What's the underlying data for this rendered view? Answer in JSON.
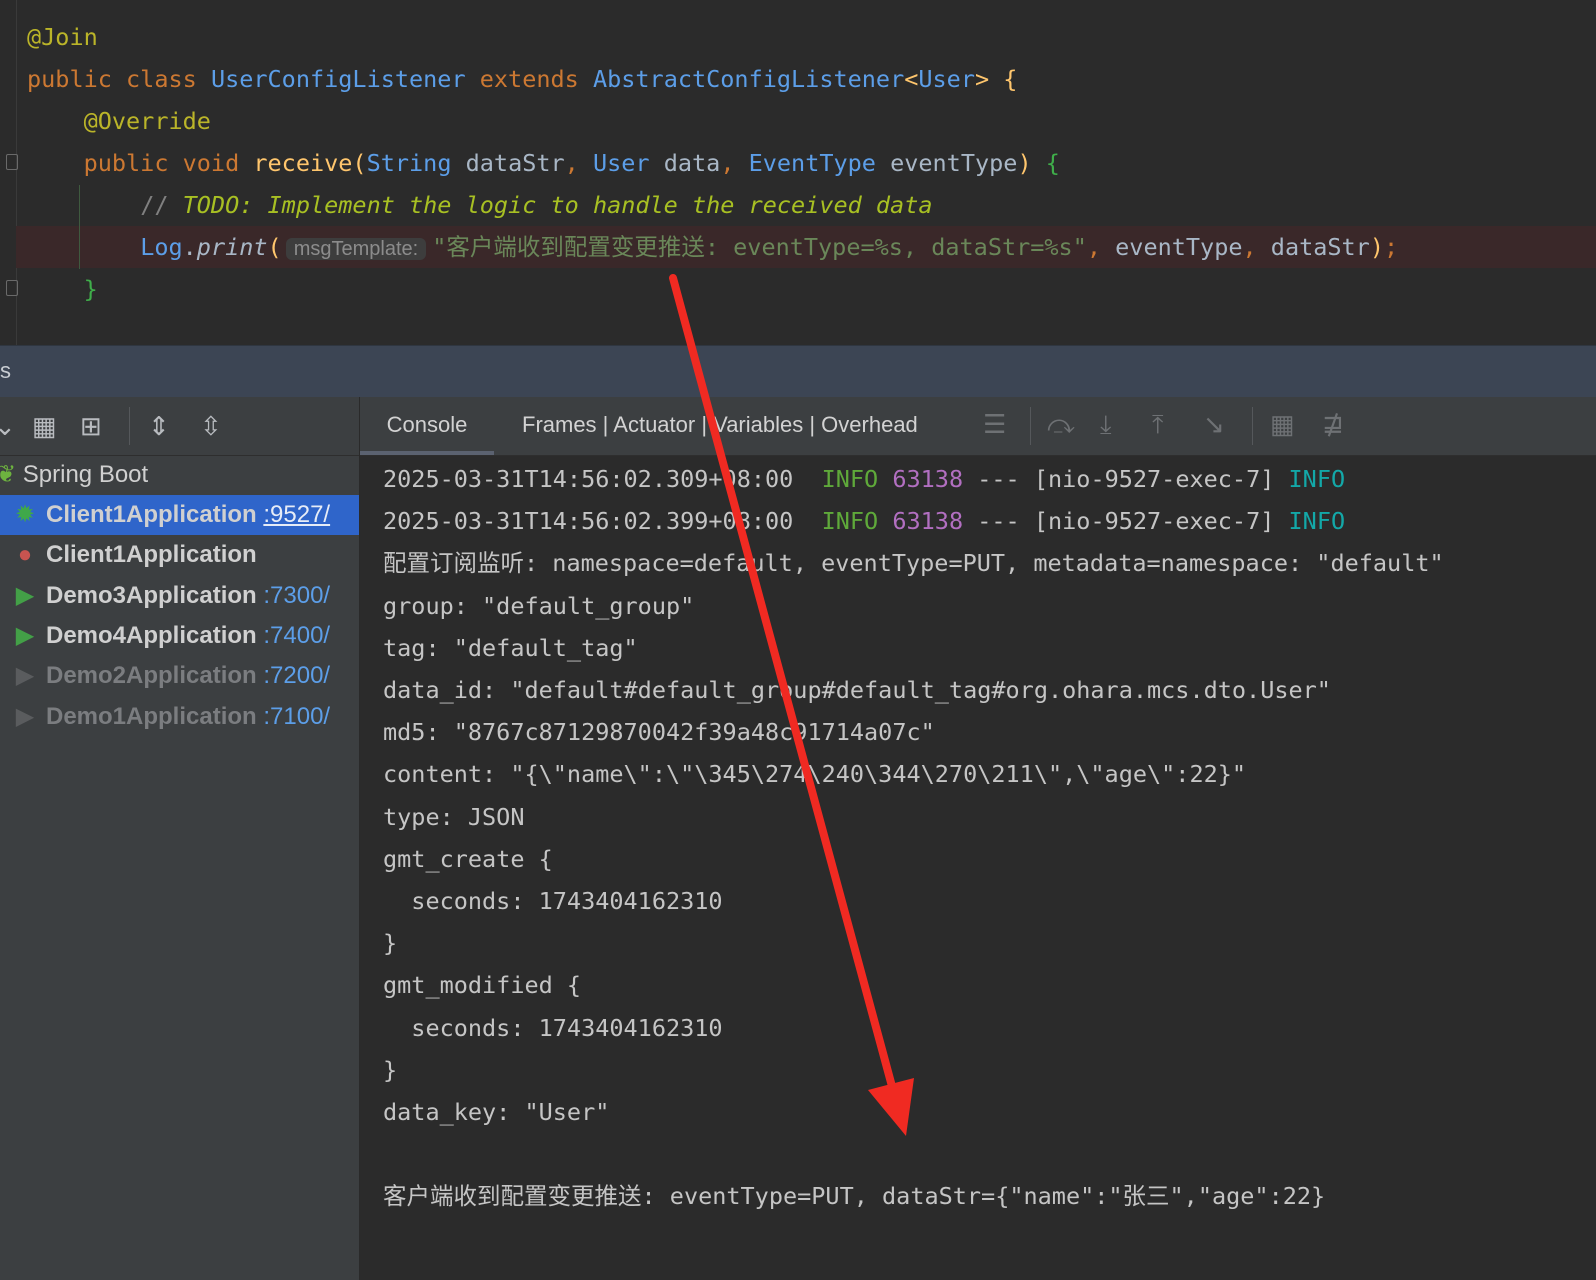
{
  "editor": {
    "lines": [
      [
        {
          "t": "@Join",
          "c": "ann"
        }
      ],
      [
        {
          "t": "public class ",
          "c": "kw"
        },
        {
          "t": "UserConfigListener ",
          "c": "ty"
        },
        {
          "t": "extends ",
          "c": "kw"
        },
        {
          "t": "AbstractConfigListener",
          "c": "ty"
        },
        {
          "t": "<",
          "c": "fn"
        },
        {
          "t": "User",
          "c": "ty"
        },
        {
          "t": "> {",
          "c": "fn"
        }
      ],
      [
        {
          "t": "    "
        },
        {
          "t": "@Override",
          "c": "ann"
        }
      ],
      [
        {
          "t": "    "
        },
        {
          "t": "public void ",
          "c": "kw"
        },
        {
          "t": "receive",
          "c": "fn"
        },
        {
          "t": "(",
          "c": "fn"
        },
        {
          "t": "String ",
          "c": "ty"
        },
        {
          "t": "dataStr",
          "c": "pl"
        },
        {
          "t": ", ",
          "c": "kw"
        },
        {
          "t": "User ",
          "c": "ty"
        },
        {
          "t": "data",
          "c": "pl"
        },
        {
          "t": ", ",
          "c": "kw"
        },
        {
          "t": "EventType ",
          "c": "ty"
        },
        {
          "t": "eventType",
          "c": "pl"
        },
        {
          "t": ") ",
          "c": "fn"
        },
        {
          "t": "{",
          "c": "br"
        }
      ],
      [
        {
          "t": "        "
        },
        {
          "t": "// ",
          "c": "cm"
        },
        {
          "t": "TODO: Implement the logic to handle the received data",
          "c": "todo"
        }
      ],
      [
        {
          "t": "        "
        },
        {
          "t": "Log",
          "c": "ln"
        },
        {
          "t": ".",
          "c": "pl"
        },
        {
          "t": "print",
          "c": "pl it"
        },
        {
          "t": "(",
          "c": "fn"
        },
        {
          "t": "msgTemplate:",
          "c": "hint"
        },
        {
          "t": "\"客户端收到配置变更推送: eventType=%s, dataStr=%s\"",
          "c": "str"
        },
        {
          "t": ", ",
          "c": "kw"
        },
        {
          "t": "eventType",
          "c": "pl"
        },
        {
          "t": ", ",
          "c": "kw"
        },
        {
          "t": "dataStr",
          "c": "pl"
        },
        {
          "t": ")",
          "c": "fn"
        },
        {
          "t": ";",
          "c": "kw"
        }
      ],
      [
        {
          "t": "    "
        },
        {
          "t": "}",
          "c": "br"
        }
      ]
    ]
  },
  "tool_window": {
    "title_fragment": "s"
  },
  "services": {
    "group_label": "Spring Boot",
    "items": [
      {
        "name": "Client1Application",
        "port": ":9527/",
        "status": "debug",
        "selected": true
      },
      {
        "name": "Client1Application",
        "port": "",
        "status": "error"
      },
      {
        "name": "Demo3Application",
        "port": ":7300/",
        "status": "running"
      },
      {
        "name": "Demo4Application",
        "port": ":7400/",
        "status": "running"
      },
      {
        "name": "Demo2Application",
        "port": ":7200/",
        "status": "stopped"
      },
      {
        "name": "Demo1Application",
        "port": ":7100/",
        "status": "stopped"
      }
    ]
  },
  "console": {
    "tabs": [
      "Console",
      "Frames | Actuator | Variables | Overhead"
    ],
    "lines": [
      [
        {
          "t": "2025-03-31T14:56:02.309+08:00  "
        },
        {
          "t": "INFO ",
          "c": "green"
        },
        {
          "t": "63138",
          "c": "purple"
        },
        {
          "t": " --- [nio-9527-exec-7] "
        },
        {
          "t": "INFO",
          "c": "cyan"
        }
      ],
      [
        {
          "t": "2025-03-31T14:56:02.399+08:00  "
        },
        {
          "t": "INFO ",
          "c": "green"
        },
        {
          "t": "63138",
          "c": "purple"
        },
        {
          "t": " --- [nio-9527-exec-7] "
        },
        {
          "t": "INFO",
          "c": "cyan"
        }
      ],
      [
        {
          "t": "配置订阅监听: namespace=default, eventType=PUT, metadata=namespace: \"default\""
        }
      ],
      [
        {
          "t": "group: \"default_group\""
        }
      ],
      [
        {
          "t": "tag: \"default_tag\""
        }
      ],
      [
        {
          "t": "data_id: \"default#default_group#default_tag#org.ohara.mcs.dto.User\""
        }
      ],
      [
        {
          "t": "md5: \"8767c87129870042f39a48c91714a07c\""
        }
      ],
      [
        {
          "t": "content: \"{\\\"name\\\":\\\"\\345\\274\\240\\344\\270\\211\\\",\\\"age\\\":22}\""
        }
      ],
      [
        {
          "t": "type: JSON"
        }
      ],
      [
        {
          "t": "gmt_create {"
        }
      ],
      [
        {
          "t": "  seconds: 1743404162310"
        }
      ],
      [
        {
          "t": "}"
        }
      ],
      [
        {
          "t": "gmt_modified {"
        }
      ],
      [
        {
          "t": "  seconds: 1743404162310"
        }
      ],
      [
        {
          "t": "}"
        }
      ],
      [
        {
          "t": "data_key: \"User\""
        }
      ],
      [
        {
          "t": ""
        }
      ],
      [
        {
          "t": "客户端收到配置变更推送: eventType=PUT, dataStr={\"name\":\"张三\",\"age\":22}"
        }
      ]
    ]
  },
  "colors": {
    "arrow": "#f02a22",
    "selection": "#2f65ca"
  }
}
